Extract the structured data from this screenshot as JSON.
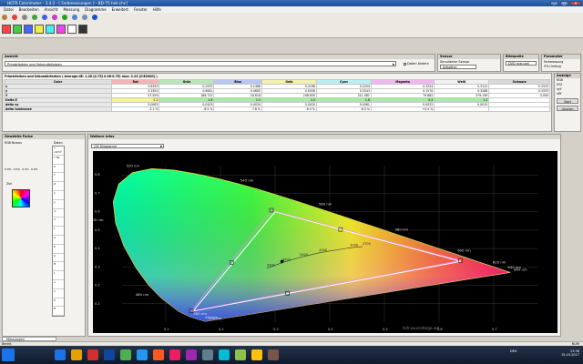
{
  "window": {
    "title": "HCFR Colorimeter - 3.4.2 - [ Farbmessungen ] - BD-75 hell.chc]",
    "min": "_",
    "max": "□",
    "close": "✕"
  },
  "menu": [
    "Datei",
    "Bearbeiten",
    "Ansicht",
    "Messung",
    "Diagramme",
    "Erweitert",
    "Fenster",
    "Hilfe"
  ],
  "toolbar_icons": [
    "disc-icon",
    "colorwheel-icon",
    "grey-icon",
    "rgb-icon",
    "dots-icon",
    "cmy-icon",
    "play-icon",
    "window-icon",
    "grid-icon",
    "help-icon"
  ],
  "ansicht": {
    "title": "Ansicht",
    "select": "Primärfarben und Sekundärfarben",
    "checkbox": "Daten ändern"
  },
  "sensor": {
    "title": "Sensor",
    "line1": "Simulierter Sensor",
    "line2": "Adaptive"
  },
  "bildquelle": {
    "title": "Bildquelle",
    "value": "DVD manuell"
  },
  "parameter": {
    "title": "Parameter",
    "opt1": "Farbmessung",
    "opt2": "ITU-Umfang"
  },
  "anzeige": {
    "title": "Anzeige",
    "opt1": "RGB",
    "opt2": "XYZ",
    "opt3": "xyY",
    "opt4": "sRY",
    "start": "Start",
    "loeschen": "Löschen"
  },
  "table": {
    "caption": "Primärfarben und Sekundärfarben ( Average dE: 1.28 [4.75] 0.98-0.75) max: 2.23 [CIE2000] )",
    "headers": [
      "Color",
      "Rot",
      "Grün",
      "Blau",
      "Gelb",
      "Cyan",
      "Magenta",
      "Weiß",
      "Schwarz"
    ],
    "header_colors": [
      "#e0e0e0",
      "#f4b4b4",
      "#b8e8b8",
      "#b8c8f4",
      "#f4f0b0",
      "#b8f0f4",
      "#f0b8f0",
      "#f0f0f0",
      "#d8d8d8"
    ],
    "rows": [
      {
        "label": "x",
        "values": [
          "0.6393",
          "0.2933",
          "0.1466",
          "0.4198",
          "0.2204",
          "0.3224",
          "0.3112",
          "0.3333"
        ]
      },
      {
        "label": "y",
        "values": [
          "0.3352",
          "0.6081",
          "0.0605",
          "0.5036",
          "0.3243",
          "0.1570",
          "0.3288",
          "0.3333"
        ]
      },
      {
        "label": "Y",
        "values": [
          "57.559",
          "188.722",
          "18.618",
          "248.630",
          "211.081",
          "79.862",
          "279.199",
          "0.000"
        ]
      },
      {
        "label": "Delta E",
        "values": [
          "2.2",
          "1.6",
          "1.5",
          "1.0",
          "1.6",
          "0.4",
          "1.2",
          ""
        ]
      },
      {
        "label": "delta xy",
        "values": [
          "0.0063",
          "0.0105",
          "0.0034",
          "0.0020",
          "0.0061",
          "0.0032",
          "0.0015",
          ""
        ]
      },
      {
        "label": "delta luminance",
        "values": [
          "-3.1 %",
          "-6.5 %",
          "-7.8 %",
          "-6.0 %",
          "-6.0 %",
          "+0.4 %",
          "",
          ""
        ]
      }
    ],
    "delta_colors": [
      "#f4f490",
      "#a8e8a8",
      "#a8e8a8",
      "#a8e8a8",
      "#a8e8a8",
      "#a8e8a8",
      "#a8e8a8",
      ""
    ]
  },
  "left_panel": {
    "title": "Gewählte Farbe",
    "rgb_label": "RGB Niveau",
    "percents": [
      "0.0%",
      "0.0%",
      "0.0%",
      "0.0%"
    ],
    "ziel": "Ziel",
    "daten": "Daten",
    "list": [
      "Y cd/m²",
      "Y ftL",
      "X",
      "Y",
      "Z",
      "x",
      "y",
      "u'",
      "v'",
      "L",
      "a",
      "b",
      "C",
      "H",
      "L",
      "u",
      "v",
      "C",
      "H"
    ]
  },
  "diagram": {
    "title": "Weitere Infos",
    "select": "CIE Diagramm",
    "watermark": "hcfr.sourceforge.net"
  },
  "chart_data": {
    "type": "scatter",
    "title": "",
    "xlabel": "",
    "ylabel": "",
    "xlim": [
      0.0,
      0.8
    ],
    "ylim": [
      0.0,
      0.9
    ],
    "x_ticks": [
      "0.1",
      "0.2",
      "0.3",
      "0.4",
      "0.5",
      "0.6",
      "0.7"
    ],
    "y_ticks": [
      "0.8",
      "0.7",
      "0.6",
      "0.5",
      "0.4",
      "0.3",
      "0.2",
      "0.1"
    ],
    "wavelength_labels": [
      {
        "text": "520 nm",
        "x": 0.0743,
        "y": 0.8338
      },
      {
        "text": "540 nm",
        "x": 0.2296,
        "y": 0.7543
      },
      {
        "text": "560 nm",
        "x": 0.3731,
        "y": 0.6245
      },
      {
        "text": "580 nm",
        "x": 0.5125,
        "y": 0.4866
      },
      {
        "text": "600 nm",
        "x": 0.627,
        "y": 0.3725
      },
      {
        "text": "620 nm",
        "x": 0.6915,
        "y": 0.3083
      },
      {
        "text": "640 nm",
        "x": 0.719,
        "y": 0.2809
      },
      {
        "text": "660 nm",
        "x": 0.73,
        "y": 0.27
      },
      {
        "text": "500 nm",
        "x": 0.0082,
        "y": 0.5384
      },
      {
        "text": "480 nm",
        "x": 0.0913,
        "y": 0.1327
      },
      {
        "text": "460 nm",
        "x": 0.144,
        "y": 0.0297
      },
      {
        "text": "440 nm",
        "x": 0.1644,
        "y": 0.0109
      },
      {
        "text": "420 nm",
        "x": 0.1714,
        "y": 0.0051
      }
    ],
    "target_gamut": [
      [
        0.64,
        0.33
      ],
      [
        0.3,
        0.6
      ],
      [
        0.15,
        0.06
      ]
    ],
    "measured_gamut": [
      [
        0.6393,
        0.3352
      ],
      [
        0.2933,
        0.6081
      ],
      [
        0.1466,
        0.0605
      ]
    ],
    "secondaries": [
      [
        0.4198,
        0.5036
      ],
      [
        0.2204,
        0.3243
      ],
      [
        0.3224,
        0.157
      ]
    ],
    "white_point": [
      0.3127,
      0.329
    ],
    "planckian_labels": [
      {
        "text": "2700",
        "x": 0.4599,
        "y": 0.4106
      },
      {
        "text": "3000",
        "x": 0.4369,
        "y": 0.4041
      },
      {
        "text": "4000",
        "x": 0.3805,
        "y": 0.3768
      },
      {
        "text": "5000",
        "x": 0.3451,
        "y": 0.3516
      },
      {
        "text": "6500",
        "x": 0.3135,
        "y": 0.3237
      },
      {
        "text": "9300",
        "x": 0.2848,
        "y": 0.2932
      }
    ]
  },
  "tabs": {
    "tab1": "Messungen"
  },
  "status": {
    "left": "Bereit",
    "right": "NUM"
  },
  "taskbar": {
    "time": "13:36",
    "date": "15.03.2017",
    "search": "Farbmessungen",
    "lang": "DEU"
  },
  "taskbar_apps": [
    "#1a73e8",
    "#e8a000",
    "#d32f2f",
    "#0d47a1",
    "#4caf50",
    "#2196f3",
    "#ff5722",
    "#e91e63",
    "#9c27b0",
    "#607d8b",
    "#00bcd4",
    "#8bc34a",
    "#ffc107",
    "#795548"
  ]
}
